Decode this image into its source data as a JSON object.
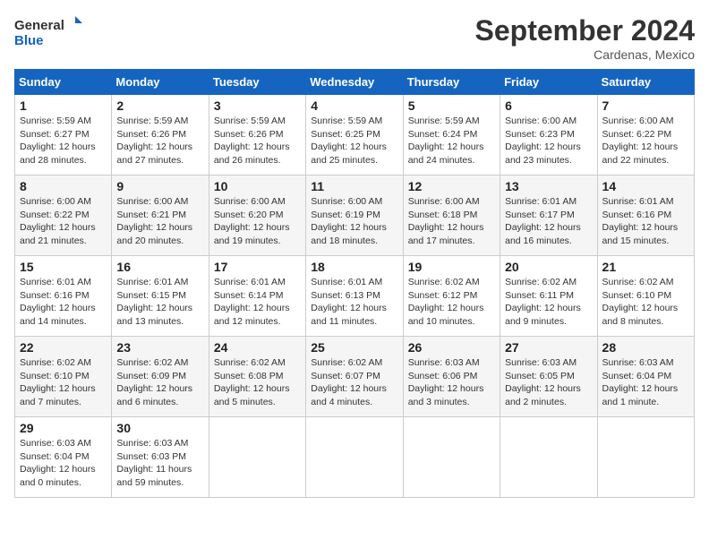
{
  "header": {
    "logo_general": "General",
    "logo_blue": "Blue",
    "month_year": "September 2024",
    "location": "Cardenas, Mexico"
  },
  "days_of_week": [
    "Sunday",
    "Monday",
    "Tuesday",
    "Wednesday",
    "Thursday",
    "Friday",
    "Saturday"
  ],
  "weeks": [
    [
      {
        "day": "1",
        "info": "Sunrise: 5:59 AM\nSunset: 6:27 PM\nDaylight: 12 hours\nand 28 minutes."
      },
      {
        "day": "2",
        "info": "Sunrise: 5:59 AM\nSunset: 6:26 PM\nDaylight: 12 hours\nand 27 minutes."
      },
      {
        "day": "3",
        "info": "Sunrise: 5:59 AM\nSunset: 6:26 PM\nDaylight: 12 hours\nand 26 minutes."
      },
      {
        "day": "4",
        "info": "Sunrise: 5:59 AM\nSunset: 6:25 PM\nDaylight: 12 hours\nand 25 minutes."
      },
      {
        "day": "5",
        "info": "Sunrise: 5:59 AM\nSunset: 6:24 PM\nDaylight: 12 hours\nand 24 minutes."
      },
      {
        "day": "6",
        "info": "Sunrise: 6:00 AM\nSunset: 6:23 PM\nDaylight: 12 hours\nand 23 minutes."
      },
      {
        "day": "7",
        "info": "Sunrise: 6:00 AM\nSunset: 6:22 PM\nDaylight: 12 hours\nand 22 minutes."
      }
    ],
    [
      {
        "day": "8",
        "info": "Sunrise: 6:00 AM\nSunset: 6:22 PM\nDaylight: 12 hours\nand 21 minutes."
      },
      {
        "day": "9",
        "info": "Sunrise: 6:00 AM\nSunset: 6:21 PM\nDaylight: 12 hours\nand 20 minutes."
      },
      {
        "day": "10",
        "info": "Sunrise: 6:00 AM\nSunset: 6:20 PM\nDaylight: 12 hours\nand 19 minutes."
      },
      {
        "day": "11",
        "info": "Sunrise: 6:00 AM\nSunset: 6:19 PM\nDaylight: 12 hours\nand 18 minutes."
      },
      {
        "day": "12",
        "info": "Sunrise: 6:00 AM\nSunset: 6:18 PM\nDaylight: 12 hours\nand 17 minutes."
      },
      {
        "day": "13",
        "info": "Sunrise: 6:01 AM\nSunset: 6:17 PM\nDaylight: 12 hours\nand 16 minutes."
      },
      {
        "day": "14",
        "info": "Sunrise: 6:01 AM\nSunset: 6:16 PM\nDaylight: 12 hours\nand 15 minutes."
      }
    ],
    [
      {
        "day": "15",
        "info": "Sunrise: 6:01 AM\nSunset: 6:16 PM\nDaylight: 12 hours\nand 14 minutes."
      },
      {
        "day": "16",
        "info": "Sunrise: 6:01 AM\nSunset: 6:15 PM\nDaylight: 12 hours\nand 13 minutes."
      },
      {
        "day": "17",
        "info": "Sunrise: 6:01 AM\nSunset: 6:14 PM\nDaylight: 12 hours\nand 12 minutes."
      },
      {
        "day": "18",
        "info": "Sunrise: 6:01 AM\nSunset: 6:13 PM\nDaylight: 12 hours\nand 11 minutes."
      },
      {
        "day": "19",
        "info": "Sunrise: 6:02 AM\nSunset: 6:12 PM\nDaylight: 12 hours\nand 10 minutes."
      },
      {
        "day": "20",
        "info": "Sunrise: 6:02 AM\nSunset: 6:11 PM\nDaylight: 12 hours\nand 9 minutes."
      },
      {
        "day": "21",
        "info": "Sunrise: 6:02 AM\nSunset: 6:10 PM\nDaylight: 12 hours\nand 8 minutes."
      }
    ],
    [
      {
        "day": "22",
        "info": "Sunrise: 6:02 AM\nSunset: 6:10 PM\nDaylight: 12 hours\nand 7 minutes."
      },
      {
        "day": "23",
        "info": "Sunrise: 6:02 AM\nSunset: 6:09 PM\nDaylight: 12 hours\nand 6 minutes."
      },
      {
        "day": "24",
        "info": "Sunrise: 6:02 AM\nSunset: 6:08 PM\nDaylight: 12 hours\nand 5 minutes."
      },
      {
        "day": "25",
        "info": "Sunrise: 6:02 AM\nSunset: 6:07 PM\nDaylight: 12 hours\nand 4 minutes."
      },
      {
        "day": "26",
        "info": "Sunrise: 6:03 AM\nSunset: 6:06 PM\nDaylight: 12 hours\nand 3 minutes."
      },
      {
        "day": "27",
        "info": "Sunrise: 6:03 AM\nSunset: 6:05 PM\nDaylight: 12 hours\nand 2 minutes."
      },
      {
        "day": "28",
        "info": "Sunrise: 6:03 AM\nSunset: 6:04 PM\nDaylight: 12 hours\nand 1 minute."
      }
    ],
    [
      {
        "day": "29",
        "info": "Sunrise: 6:03 AM\nSunset: 6:04 PM\nDaylight: 12 hours\nand 0 minutes."
      },
      {
        "day": "30",
        "info": "Sunrise: 6:03 AM\nSunset: 6:03 PM\nDaylight: 11 hours\nand 59 minutes."
      },
      {
        "day": "",
        "info": ""
      },
      {
        "day": "",
        "info": ""
      },
      {
        "day": "",
        "info": ""
      },
      {
        "day": "",
        "info": ""
      },
      {
        "day": "",
        "info": ""
      }
    ]
  ]
}
